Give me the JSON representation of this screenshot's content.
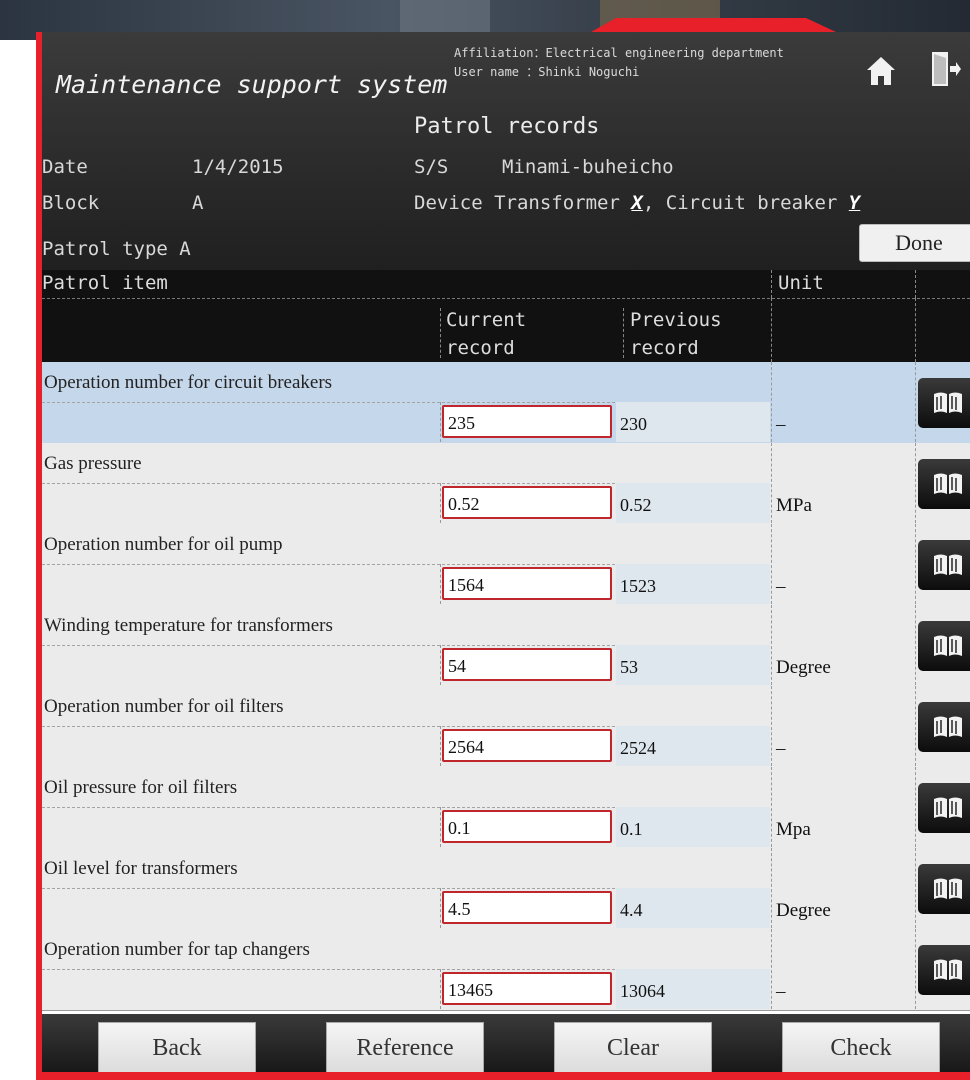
{
  "app": {
    "title": "Maintenance support system",
    "affiliation": "Affiliation：Electrical engineering department",
    "user": "User name  ：Shinki Noguchi"
  },
  "page": {
    "subtitle": "Patrol records",
    "date_label": "Date",
    "date_value": "1/4/2015",
    "ss_label": "S/S",
    "ss_value": "Minami-buheicho",
    "block_label": "Block",
    "block_value": "A",
    "device_label": "Device",
    "device_transformer": "Transformer",
    "device_transformer_code": "X",
    "device_breaker": "Circuit breaker",
    "device_breaker_code": "Y",
    "patrol_type": "Patrol type A",
    "done_label": "Done"
  },
  "table": {
    "col_item": "Patrol item",
    "col_unit": "Unit",
    "col_current": [
      "Current",
      "record"
    ],
    "col_previous": [
      "Previous",
      "record"
    ],
    "rows": [
      {
        "name": "Operation number for circuit breakers",
        "current": "235",
        "previous": "230",
        "unit": "–"
      },
      {
        "name": "Gas pressure",
        "current": "0.52",
        "previous": "0.52",
        "unit": "MPa"
      },
      {
        "name": "Operation number for oil pump",
        "current": "1564",
        "previous": "1523",
        "unit": "–"
      },
      {
        "name": "Winding temperature for transformers",
        "current": "54",
        "previous": "53",
        "unit": "Degree"
      },
      {
        "name": "Operation number for oil filters",
        "current": "2564",
        "previous": "2524",
        "unit": "–"
      },
      {
        "name": "Oil pressure for oil filters",
        "current": "0.1",
        "previous": "0.1",
        "unit": "Mpa"
      },
      {
        "name": "Oil level for transformers",
        "current": "4.5",
        "previous": "4.4",
        "unit": "Degree"
      },
      {
        "name": "Operation number for tap changers",
        "current": "13465",
        "previous": "13064",
        "unit": "–"
      }
    ]
  },
  "footer": {
    "back": "Back",
    "reference": "Reference",
    "clear": "Clear",
    "check": "Check"
  },
  "colors": {
    "frame": "#e8202a",
    "input_border": "#c0272d",
    "selected_row": "#c5d7ea"
  },
  "icons": [
    "home-icon",
    "exit-icon",
    "manual-book-icon"
  ]
}
